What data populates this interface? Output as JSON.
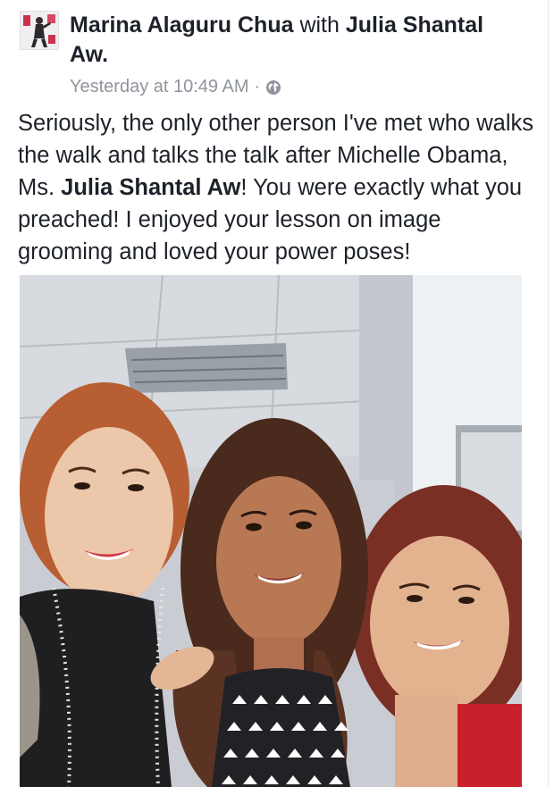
{
  "post": {
    "author": "Marina Alaguru Chua",
    "connector": "with",
    "tagged": "Julia Shantal Aw.",
    "timestamp": "Yesterday at 10:49 AM",
    "separator": "·",
    "privacy_icon": "globe-icon",
    "text_part1": "Seriously, the only other person I've met who walks the walk and talks the talk after Michelle Obama, Ms. ",
    "text_mention": "Julia Shantal Aw",
    "text_part2": "! You were exactly what you preached! I enjoyed your lesson on image grooming and loved your power poses!"
  },
  "colors": {
    "text": "#1d2129",
    "meta": "#90949c",
    "background": "#ffffff"
  }
}
